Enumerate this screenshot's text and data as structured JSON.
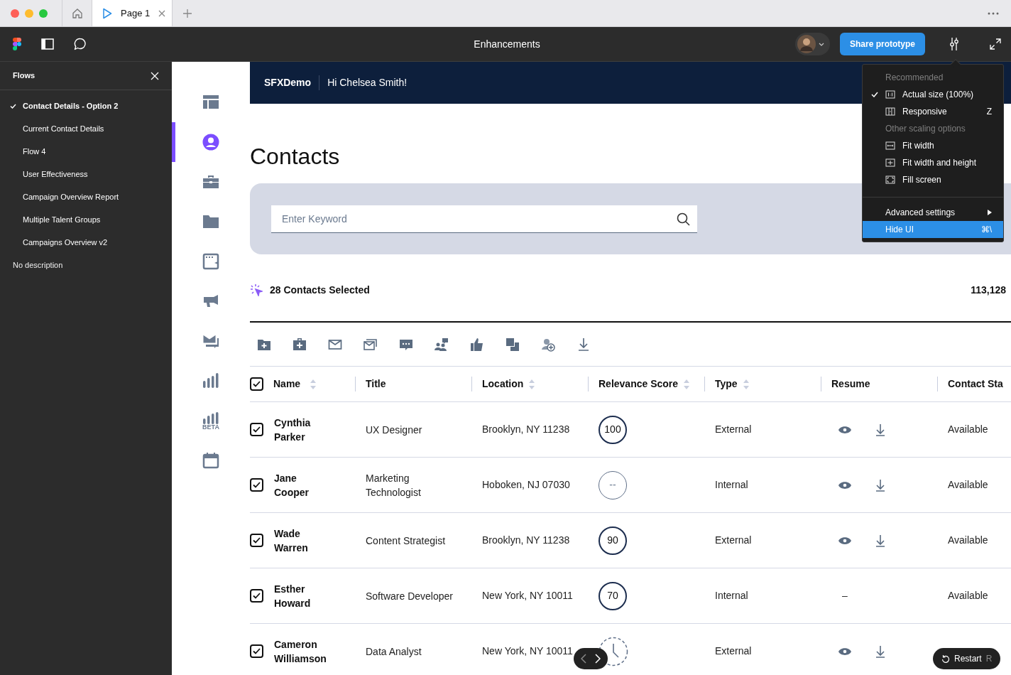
{
  "browser": {
    "tabs": [
      {
        "label": "Page 1",
        "selected": true
      }
    ]
  },
  "toolbar": {
    "title": "Enhancements",
    "share_button": "Share prototype"
  },
  "flows_panel": {
    "title": "Flows",
    "items": [
      {
        "label": "Contact Details - Option 2",
        "selected": true
      },
      {
        "label": "Current Contact Details",
        "selected": false
      },
      {
        "label": "Flow 4",
        "selected": false
      },
      {
        "label": "User Effectiveness",
        "selected": false
      },
      {
        "label": "Campaign Overview Report",
        "selected": false
      },
      {
        "label": "Multiple Talent Groups",
        "selected": false
      },
      {
        "label": "Campaigns Overview v2",
        "selected": false
      }
    ],
    "description": "No description"
  },
  "rail": {
    "items": [
      {
        "selected": false
      },
      {
        "selected": true
      },
      {
        "selected": false
      },
      {
        "selected": false
      },
      {
        "selected": false
      },
      {
        "selected": false
      },
      {
        "selected": false
      },
      {
        "selected": false
      },
      {
        "selected": false,
        "badge": "BETA"
      },
      {
        "selected": false
      }
    ]
  },
  "app_header": {
    "brand": "SFXDemo",
    "greeting": "Hi Chelsea Smith!"
  },
  "page_title": "Contacts",
  "search": {
    "placeholder": "Enter Keyword"
  },
  "selection": {
    "label": "28 Contacts Selected",
    "total": "113,128"
  },
  "table": {
    "all_checked": true,
    "columns": [
      {
        "label": "Name",
        "sortable": true
      },
      {
        "label": "Title",
        "sortable": false
      },
      {
        "label": "Location",
        "sortable": true
      },
      {
        "label": "Relevance Score",
        "sortable": true
      },
      {
        "label": "Type",
        "sortable": true
      },
      {
        "label": "Resume",
        "sortable": false
      },
      {
        "label": "Contact Sta",
        "sortable": false
      }
    ],
    "rows": [
      {
        "checked": true,
        "name": "Cynthia Parker",
        "title": "UX Designer",
        "location": "Brooklyn, NY 11238",
        "score": {
          "kind": "value",
          "text": "100"
        },
        "type": "External",
        "resume": {
          "available": true
        },
        "status": "Available"
      },
      {
        "checked": true,
        "name": "Jane Cooper",
        "title": "Marketing Technologist",
        "location": "Hoboken, NJ 07030",
        "score": {
          "kind": "empty",
          "text": "--"
        },
        "type": "Internal",
        "resume": {
          "available": true
        },
        "status": "Available"
      },
      {
        "checked": true,
        "name": "Wade Warren",
        "title": "Content Strategist",
        "location": "Brooklyn, NY 11238",
        "score": {
          "kind": "value",
          "text": "90"
        },
        "type": "External",
        "resume": {
          "available": true
        },
        "status": "Available"
      },
      {
        "checked": true,
        "name": "Esther Howard",
        "title": "Software Developer",
        "location": "New York, NY 10011",
        "score": {
          "kind": "value",
          "text": "70"
        },
        "type": "Internal",
        "resume": {
          "available": false,
          "text": "–"
        },
        "status": "Available"
      },
      {
        "checked": true,
        "name": "Cameron Williamson",
        "title": "Data Analyst",
        "location": "New York, NY 10011",
        "score": {
          "kind": "pending"
        },
        "type": "External",
        "resume": {
          "available": true
        }
      }
    ]
  },
  "scale_menu": {
    "items": [
      {
        "kind": "heading",
        "text": "Recommended"
      },
      {
        "kind": "scale",
        "label": "Actual size (100%)",
        "checked": true,
        "selected": false
      },
      {
        "kind": "scale",
        "label": "Responsive",
        "checked": false,
        "selected": false,
        "shortcut": "Z"
      },
      {
        "kind": "heading",
        "text": "Other scaling options"
      },
      {
        "kind": "scale",
        "label": "Fit width",
        "checked": false,
        "selected": false
      },
      {
        "kind": "scale",
        "label": "Fit width and height",
        "checked": false,
        "selected": false
      },
      {
        "kind": "scale",
        "label": "Fill screen",
        "checked": false,
        "selected": false
      },
      {
        "kind": "divider"
      },
      {
        "kind": "submenu",
        "label": "Advanced settings",
        "selected": false
      },
      {
        "kind": "action",
        "label": "Hide UI",
        "selected": true,
        "shortcut": "⌘\\"
      }
    ]
  },
  "player": {
    "restart": "Restart",
    "restart_shortcut": "R"
  }
}
